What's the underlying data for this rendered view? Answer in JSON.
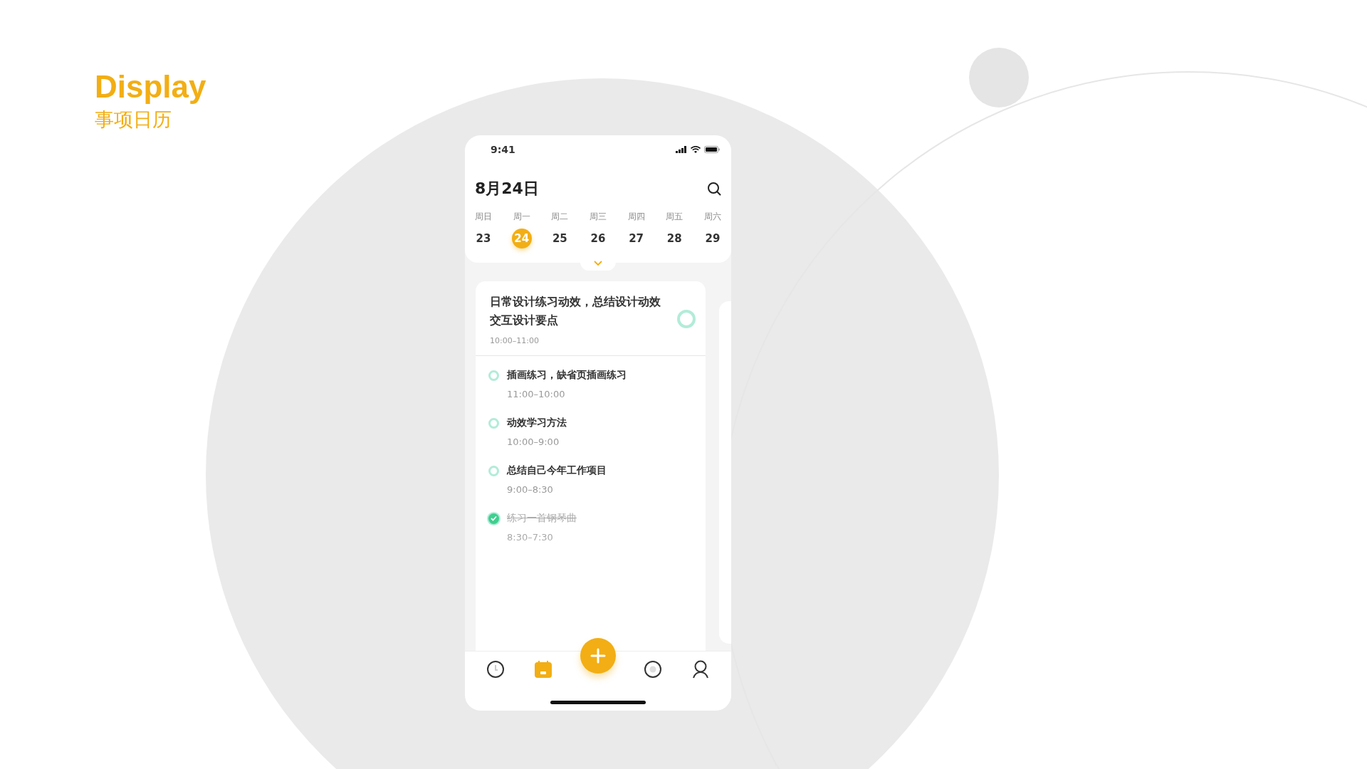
{
  "page": {
    "title": "Display",
    "subtitle": "事项日历"
  },
  "status_bar": {
    "time": "9:41"
  },
  "header": {
    "date": "8月24日"
  },
  "week": [
    {
      "label": "周日",
      "day": "23",
      "selected": false
    },
    {
      "label": "周一",
      "day": "24",
      "selected": true
    },
    {
      "label": "周二",
      "day": "25",
      "selected": false
    },
    {
      "label": "周三",
      "day": "26",
      "selected": false
    },
    {
      "label": "周四",
      "day": "27",
      "selected": false
    },
    {
      "label": "周五",
      "day": "28",
      "selected": false
    },
    {
      "label": "周六",
      "day": "29",
      "selected": false
    }
  ],
  "featured": {
    "title": "日常设计练习动效，总结设计动效交互设计要点",
    "time": "10:00–11:00",
    "done": false
  },
  "tasks": [
    {
      "title": "插画练习，缺省页插画练习",
      "time": "11:00–10:00",
      "done": false
    },
    {
      "title": "动效学习方法",
      "time": "10:00–9:00",
      "done": false
    },
    {
      "title": "总结自己今年工作项目",
      "time": "9:00–8:30",
      "done": false
    },
    {
      "title": "练习一首钢琴曲",
      "time": "8:30–7:30",
      "done": true
    }
  ],
  "nav": [
    {
      "kind": "clock",
      "selected": false
    },
    {
      "kind": "calendar",
      "selected": true
    },
    {
      "kind": "add"
    },
    {
      "kind": "record",
      "selected": false
    },
    {
      "kind": "profile",
      "selected": false
    }
  ]
}
